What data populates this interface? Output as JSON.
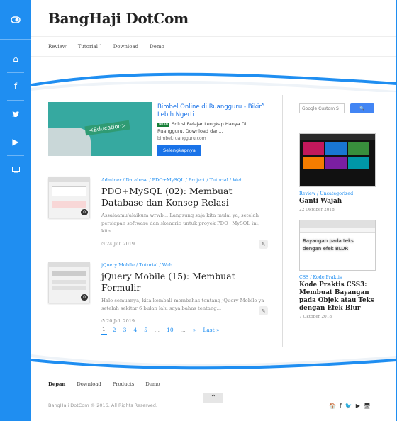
{
  "site": {
    "title": "BangHaji DotCom"
  },
  "sidebar": {
    "icons": [
      "toggle-icon",
      "home-icon",
      "facebook-icon",
      "twitter-icon",
      "youtube-icon",
      "desktop-icon"
    ]
  },
  "nav": {
    "items": [
      "Review",
      "Tutorial ˅",
      "Download",
      "Demo"
    ]
  },
  "ad": {
    "title": "Bimbel Online di Ruangguru - Bikin Lebih Ngerti",
    "badge_label": "Iklan",
    "description": "Solusi Belajar Lengkap Hanya Di Ruangguru. Download dan...",
    "url": "bimbel.ruangguru.com",
    "button": "Selengkapnya",
    "image_text": "<Education>",
    "close": "✕"
  },
  "posts": [
    {
      "categories": "Adminer / Database / PDO+MySQL / Project / Tutorial / Web",
      "title": "PDO+MySQL (02): Membuat Database dan Konsep Relasi",
      "excerpt": "Assalaamu'alaikum wrwb... Langsung saja kita mulai ya, setelah persiapan software dan skenario untuk proyek PDO+MySQL ini, kita...",
      "date": "24 Juli 2019",
      "comments": "0"
    },
    {
      "categories": "jQuery Mobile / Tutorial / Web",
      "title": "jQuery Mobile (15): Membuat Formulir",
      "excerpt": "Halo semuanya, kita kembali membahas tentang jQuery Mobile ya setelah sekitar 6 bulan lalu saya bahas tentang...",
      "date": "20 Juli 2019",
      "comments": "0"
    }
  ],
  "pager": {
    "items": [
      "1",
      "2",
      "3",
      "4",
      "5",
      "...",
      "10",
      "...",
      "»",
      "Last »"
    ]
  },
  "search": {
    "placeholder": "Google Custom S",
    "button": "🔍"
  },
  "recent": [
    {
      "categories": "Review / Uncategorized",
      "title": "Ganti Wajah",
      "date": "22 Oktober 2018"
    },
    {
      "categories": "CSS / Kode Praktis",
      "title": "Kode Praktis CSS3: Membuat Bayangan pada Objek atau Teks dengan Efek Blur",
      "date": "7 Oktober 2018",
      "image_text": "Bayangan pada teks dengan efek BLUR"
    }
  ],
  "footer": {
    "nav": [
      "Depan",
      "Download",
      "Products",
      "Demo"
    ],
    "copyright": "BangHaji DotCom © 2016. All Rights Reserved.",
    "up": "⌃",
    "social": [
      "🏠",
      "f",
      "🐦",
      "▶",
      "🖥"
    ]
  }
}
